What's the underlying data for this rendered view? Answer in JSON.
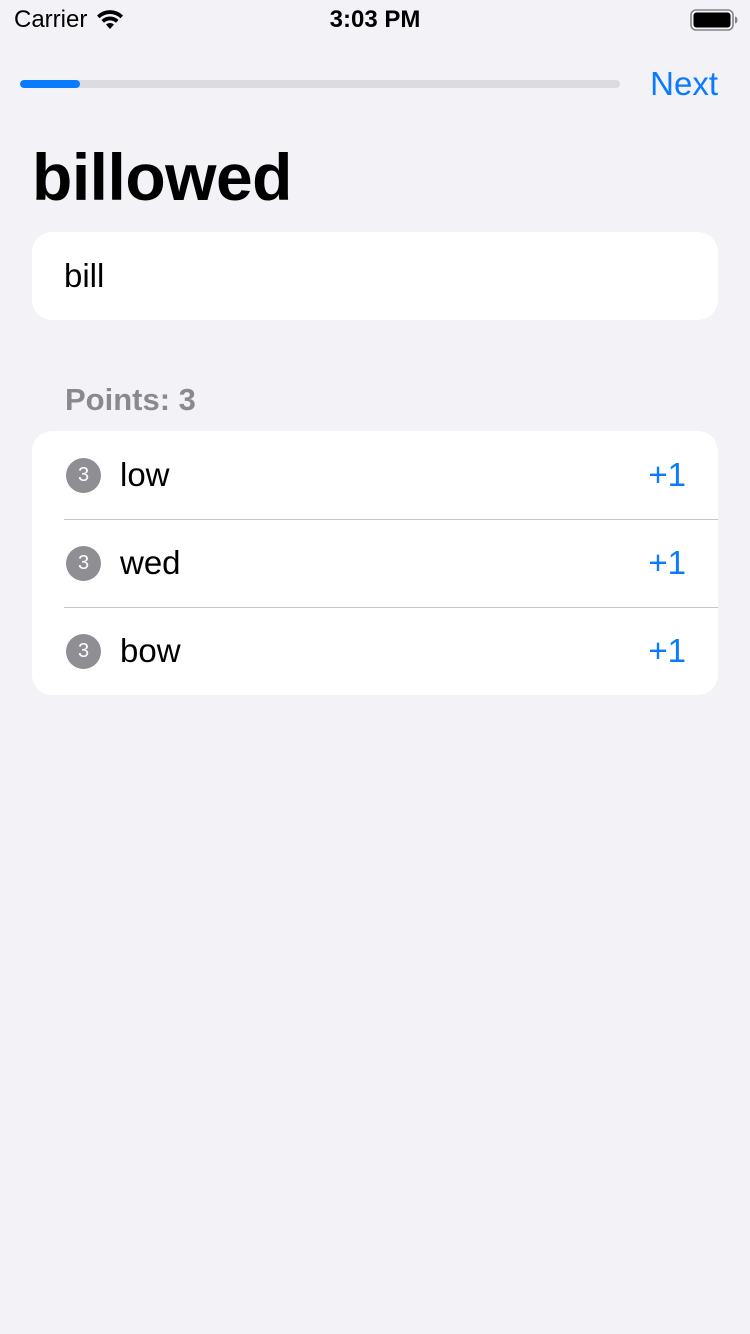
{
  "status_bar": {
    "carrier": "Carrier",
    "time": "3:03 PM",
    "icons": [
      "wifi-icon",
      "battery-icon"
    ]
  },
  "nav": {
    "progress_fraction": 0.1,
    "next_label": "Next"
  },
  "title": "billowed",
  "input": {
    "value": "bill",
    "placeholder": ""
  },
  "section": {
    "header": "Points: 3"
  },
  "words": [
    {
      "badge": "3",
      "word": "low",
      "score": "+1"
    },
    {
      "badge": "3",
      "word": "wed",
      "score": "+1"
    },
    {
      "badge": "3",
      "word": "bow",
      "score": "+1"
    }
  ],
  "colors": {
    "accent": "#0a7aff",
    "background": "#f2f2f7",
    "badge": "#8e8e93",
    "secondary_text": "#8a8a8e"
  }
}
